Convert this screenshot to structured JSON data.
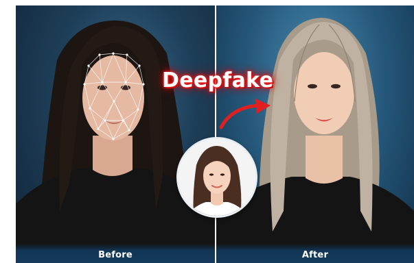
{
  "overlay": {
    "title": "Deepfake"
  },
  "panels": {
    "before": {
      "caption": "Before"
    },
    "after": {
      "caption": "After"
    }
  },
  "colors": {
    "title_glow": "#e01010",
    "arrow": "#e02020",
    "background": "#1e3f59",
    "caption_bar": "#143a5c"
  }
}
